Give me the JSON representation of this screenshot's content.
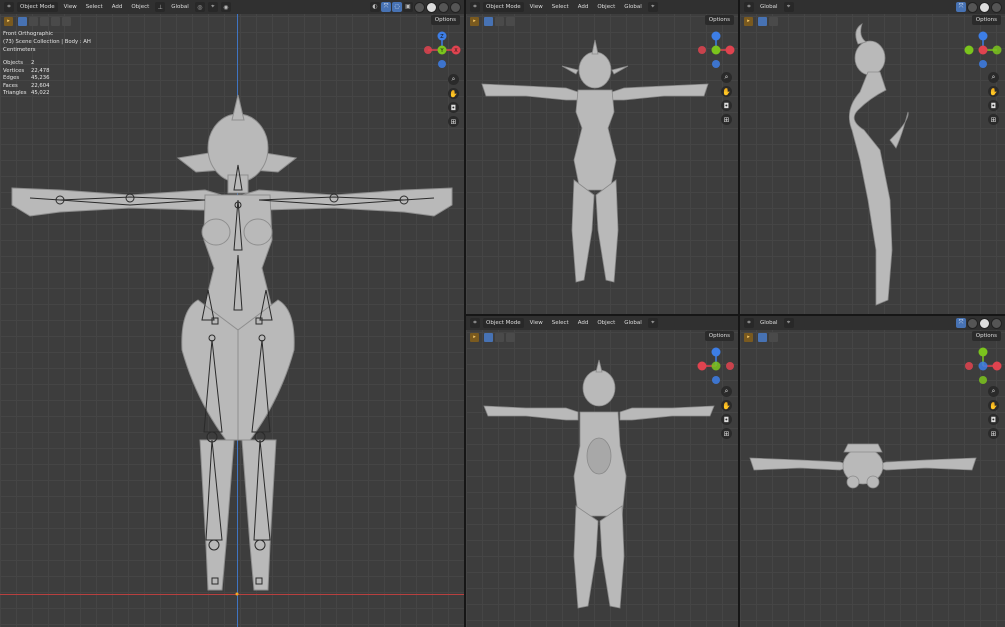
{
  "header": {
    "mode_label": "Object Mode",
    "menu": [
      "View",
      "Select",
      "Add",
      "Object"
    ],
    "transform_orientation": "Global",
    "options_label": "Options"
  },
  "main_view": {
    "view_name": "Front Orthographic",
    "collection": "(73) Scene Collection | Body : AH",
    "units": "Centimeters",
    "stats": [
      {
        "label": "Objects",
        "value": "2"
      },
      {
        "label": "Vertices",
        "value": "22,478"
      },
      {
        "label": "Edges",
        "value": "45,236"
      },
      {
        "label": "Faces",
        "value": "22,604"
      },
      {
        "label": "Triangles",
        "value": "45,022"
      }
    ]
  },
  "gizmo": {
    "front": {
      "top": "Z",
      "left": "-X",
      "center": "Y",
      "right": "X"
    },
    "side": {
      "top": "Z",
      "left": "Y",
      "center": "X",
      "right": "-Y"
    },
    "back": {
      "top": "Z",
      "left": "X",
      "center": "-Y",
      "right": "-X"
    },
    "bottom": {
      "top": "Y",
      "left": "-X",
      "center": "-Z",
      "right": "X"
    }
  },
  "icons": [
    "editor-type-icon",
    "zoom-icon",
    "hand-pan-icon",
    "camera-icon",
    "grid-ortho-icon"
  ],
  "colors": {
    "x_axis": "#e0434f",
    "y_axis": "#7bc41d",
    "z_axis": "#3d7ee6",
    "viewport": "#3d3d3d",
    "header": "#303030",
    "model": "#b9b9b9"
  }
}
